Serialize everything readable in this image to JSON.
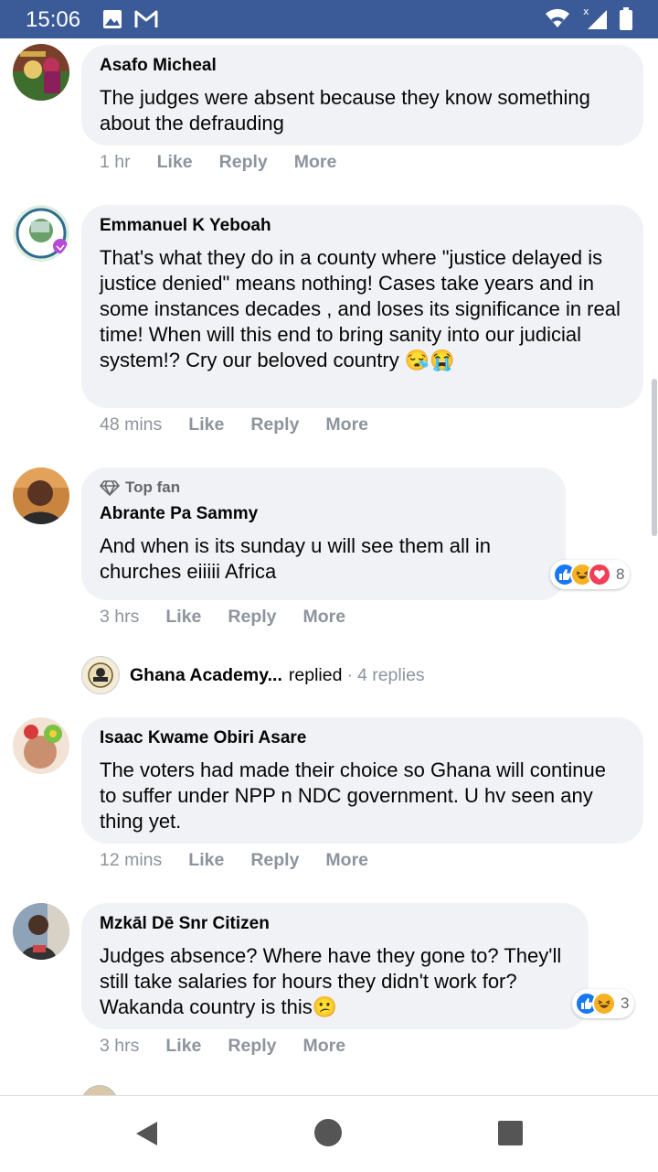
{
  "status_bar": {
    "time": "15:06"
  },
  "comments": [
    {
      "author": "Asafo Micheal",
      "text": "The judges were absent because they know something about the defrauding",
      "time": "1 hr",
      "like": "Like",
      "reply": "Reply",
      "more": "More"
    },
    {
      "author": "Emmanuel K Yeboah",
      "text": "That's what they do in a county where \"justice delayed is justice denied\" means nothing! Cases take years and in some instances decades , and loses its significance in real time! When will this end to bring sanity into our judicial system!? Cry our beloved country 😪😭",
      "time": "48 mins",
      "like": "Like",
      "reply": "Reply",
      "more": "More"
    },
    {
      "badge": "Top fan",
      "author": "Abrante Pa Sammy",
      "text": "And when is its sunday u will see them all in churches eiiiii Africa",
      "time": "3 hrs",
      "like": "Like",
      "reply": "Reply",
      "more": "More",
      "reaction_count": "8"
    },
    {
      "author": "Isaac Kwame Obiri Asare",
      "text": "The voters had made their choice so Ghana will continue to suffer under NPP n NDC government. U hv seen any thing yet.",
      "time": "12 mins",
      "like": "Like",
      "reply": "Reply",
      "more": "More"
    },
    {
      "author": "Mzkāl Dē Snr Citizen",
      "text": "Judges absence? Where have they gone to? They'll still take salaries for hours they didn't work for? Wakanda country is this😕",
      "time": "3 hrs",
      "like": "Like",
      "reply": "Reply",
      "more": "More",
      "reaction_count": "3"
    }
  ],
  "reply_summary": {
    "name": "Ghana Academy...",
    "action": "replied",
    "count": "4 replies"
  },
  "colors": {
    "status_bar": "#3b5a98",
    "bubble": "#f0f2f5",
    "like_blue": "#1877f2",
    "love_red": "#f33e58",
    "haha_yellow": "#f7b125"
  }
}
